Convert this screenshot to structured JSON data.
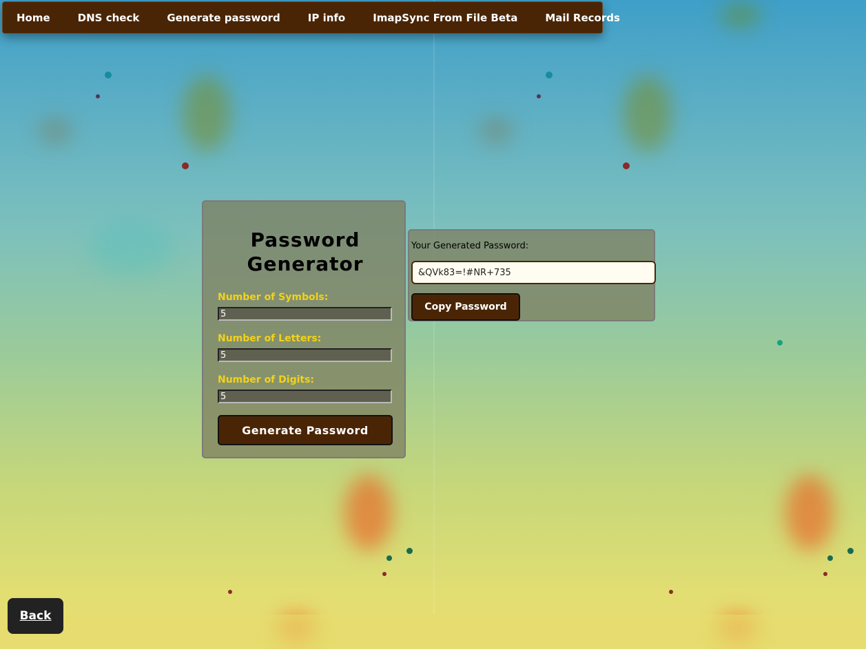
{
  "nav": {
    "items": [
      {
        "label": "Home"
      },
      {
        "label": "DNS check"
      },
      {
        "label": "Generate password"
      },
      {
        "label": "IP info"
      },
      {
        "label": "ImapSync From File Beta"
      },
      {
        "label": "Mail Records"
      }
    ]
  },
  "generator": {
    "title": "Password Generator",
    "symbols_label": "Number of Symbols:",
    "symbols_value": "5",
    "letters_label": "Number of Letters:",
    "letters_value": "5",
    "digits_label": "Number of Digits:",
    "digits_value": "5",
    "generate_label": "Generate Password"
  },
  "result": {
    "label": "Your Generated Password:",
    "password": "&QVk83=!#NR+735",
    "copy_label": "Copy Password"
  },
  "back": {
    "label": "Back"
  },
  "colors": {
    "brand_brown": "#4a2505",
    "label_yellow": "#f2d21a",
    "back_dark": "#222222"
  }
}
